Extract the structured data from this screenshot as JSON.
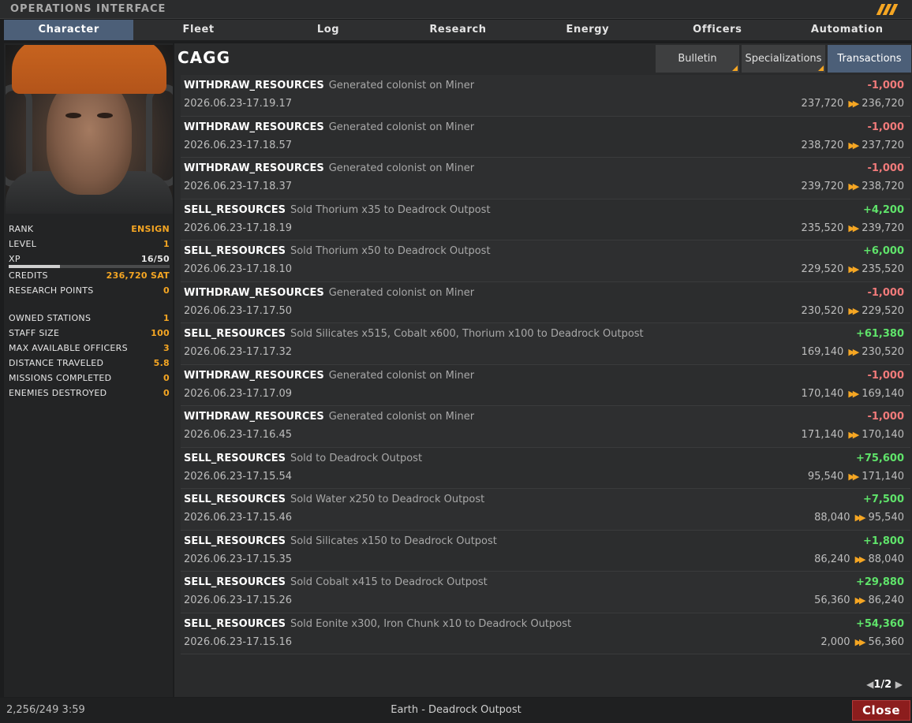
{
  "window": {
    "title": "OPERATIONS INTERFACE"
  },
  "tabs": [
    {
      "label": "Character",
      "active": true
    },
    {
      "label": "Fleet"
    },
    {
      "label": "Log"
    },
    {
      "label": "Research"
    },
    {
      "label": "Energy"
    },
    {
      "label": "Officers"
    },
    {
      "label": "Automation"
    }
  ],
  "character": {
    "name": "CAGG",
    "stats": [
      {
        "key": "RANK",
        "value": "ENSIGN"
      },
      {
        "key": "LEVEL",
        "value": "1"
      },
      {
        "key": "XP",
        "value": "16/50"
      }
    ],
    "xp_fraction": 0.32,
    "stats2": [
      {
        "key": "CREDITS",
        "value": "236,720 SAT"
      },
      {
        "key": "RESEARCH POINTS",
        "value": "0"
      }
    ],
    "stats3": [
      {
        "key": "OWNED STATIONS",
        "value": "1"
      },
      {
        "key": "STAFF SIZE",
        "value": "100"
      },
      {
        "key": "MAX AVAILABLE OFFICERS",
        "value": "3"
      },
      {
        "key": "DISTANCE TRAVELED",
        "value": "5.8"
      },
      {
        "key": "MISSIONS COMPLETED",
        "value": "0"
      },
      {
        "key": "ENEMIES DESTROYED",
        "value": "0"
      }
    ]
  },
  "subtabs": [
    {
      "label": "Bulletin"
    },
    {
      "label": "Specializations"
    },
    {
      "label": "Transactions",
      "active": true
    }
  ],
  "transactions": [
    {
      "type": "WITHDRAW_RESOURCES",
      "desc": "Generated colonist on Miner",
      "date": "2026.06.23-17.19.17",
      "delta": "-1,000",
      "from": "237,720",
      "to": "236,720"
    },
    {
      "type": "WITHDRAW_RESOURCES",
      "desc": "Generated colonist on Miner",
      "date": "2026.06.23-17.18.57",
      "delta": "-1,000",
      "from": "238,720",
      "to": "237,720"
    },
    {
      "type": "WITHDRAW_RESOURCES",
      "desc": "Generated colonist on Miner",
      "date": "2026.06.23-17.18.37",
      "delta": "-1,000",
      "from": "239,720",
      "to": "238,720"
    },
    {
      "type": "SELL_RESOURCES",
      "desc": "Sold Thorium x35 to Deadrock Outpost",
      "date": "2026.06.23-17.18.19",
      "delta": "+4,200",
      "from": "235,520",
      "to": "239,720"
    },
    {
      "type": "SELL_RESOURCES",
      "desc": "Sold Thorium x50 to Deadrock Outpost",
      "date": "2026.06.23-17.18.10",
      "delta": "+6,000",
      "from": "229,520",
      "to": "235,520"
    },
    {
      "type": "WITHDRAW_RESOURCES",
      "desc": "Generated colonist on Miner",
      "date": "2026.06.23-17.17.50",
      "delta": "-1,000",
      "from": "230,520",
      "to": "229,520"
    },
    {
      "type": "SELL_RESOURCES",
      "desc": "Sold Silicates x515, Cobalt x600, Thorium x100 to Deadrock Outpost",
      "date": "2026.06.23-17.17.32",
      "delta": "+61,380",
      "from": "169,140",
      "to": "230,520"
    },
    {
      "type": "WITHDRAW_RESOURCES",
      "desc": "Generated colonist on Miner",
      "date": "2026.06.23-17.17.09",
      "delta": "-1,000",
      "from": "170,140",
      "to": "169,140"
    },
    {
      "type": "WITHDRAW_RESOURCES",
      "desc": "Generated colonist on Miner",
      "date": "2026.06.23-17.16.45",
      "delta": "-1,000",
      "from": "171,140",
      "to": "170,140"
    },
    {
      "type": "SELL_RESOURCES",
      "desc": "Sold  to Deadrock Outpost",
      "date": "2026.06.23-17.15.54",
      "delta": "+75,600",
      "from": "95,540",
      "to": "171,140"
    },
    {
      "type": "SELL_RESOURCES",
      "desc": "Sold Water x250 to Deadrock Outpost",
      "date": "2026.06.23-17.15.46",
      "delta": "+7,500",
      "from": "88,040",
      "to": "95,540"
    },
    {
      "type": "SELL_RESOURCES",
      "desc": "Sold Silicates x150 to Deadrock Outpost",
      "date": "2026.06.23-17.15.35",
      "delta": "+1,800",
      "from": "86,240",
      "to": "88,040"
    },
    {
      "type": "SELL_RESOURCES",
      "desc": "Sold Cobalt x415 to Deadrock Outpost",
      "date": "2026.06.23-17.15.26",
      "delta": "+29,880",
      "from": "56,360",
      "to": "86,240"
    },
    {
      "type": "SELL_RESOURCES",
      "desc": "Sold Eonite x300, Iron Chunk x10 to Deadrock Outpost",
      "date": "2026.06.23-17.15.16",
      "delta": "+54,360",
      "from": "2,000",
      "to": "56,360"
    }
  ],
  "pager": {
    "label": "1/2"
  },
  "status": {
    "left": "2,256/249 3:59",
    "location": "Earth - Deadrock Outpost",
    "close_label": "Close"
  },
  "colors": {
    "accent": "#f5a623",
    "active_tab": "#4c5f78",
    "negative": "#f07a7a",
    "positive": "#5fe36a",
    "close": "#8c1d1d"
  }
}
